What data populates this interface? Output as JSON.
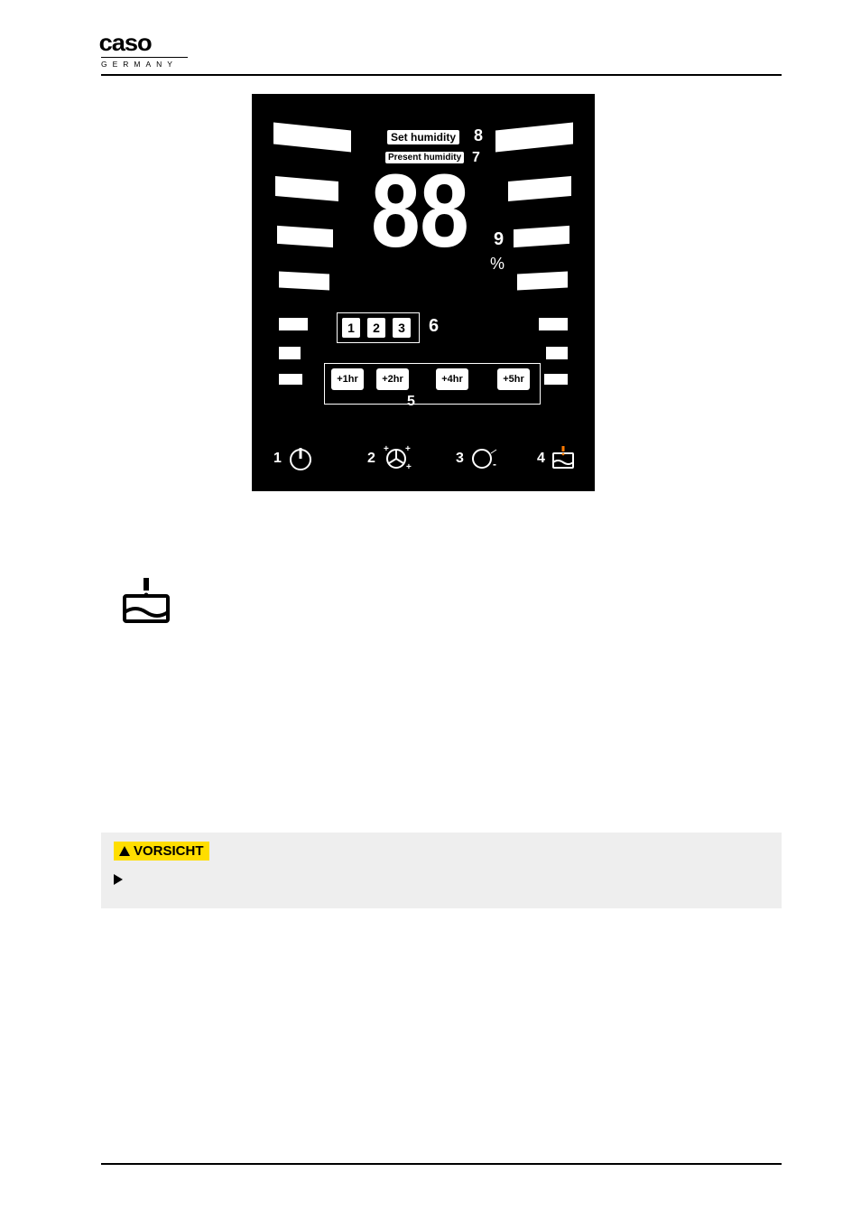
{
  "logo": {
    "brand": "caso",
    "subline": "GERMANY"
  },
  "lcd": {
    "set_humidity_label": "Set humidity",
    "present_humidity_label": "Present humidity",
    "callouts": {
      "c1": "1",
      "c2": "2",
      "c3": "3",
      "c4": "4",
      "c5": "5",
      "c6": "6",
      "c7": "7",
      "c8": "8",
      "c9": "9"
    },
    "digits": "88",
    "percent": "%",
    "mode_boxes": [
      "1",
      "2",
      "3"
    ],
    "timer_boxes": [
      "+1hr",
      "+2hr",
      "+4hr",
      "+5hr"
    ]
  },
  "icons": {
    "power": "power-icon",
    "fan": "fan-icon",
    "minus": "minus-icon",
    "tank_full": "tank-full-icon"
  },
  "caution": {
    "label": "VORSICHT"
  }
}
